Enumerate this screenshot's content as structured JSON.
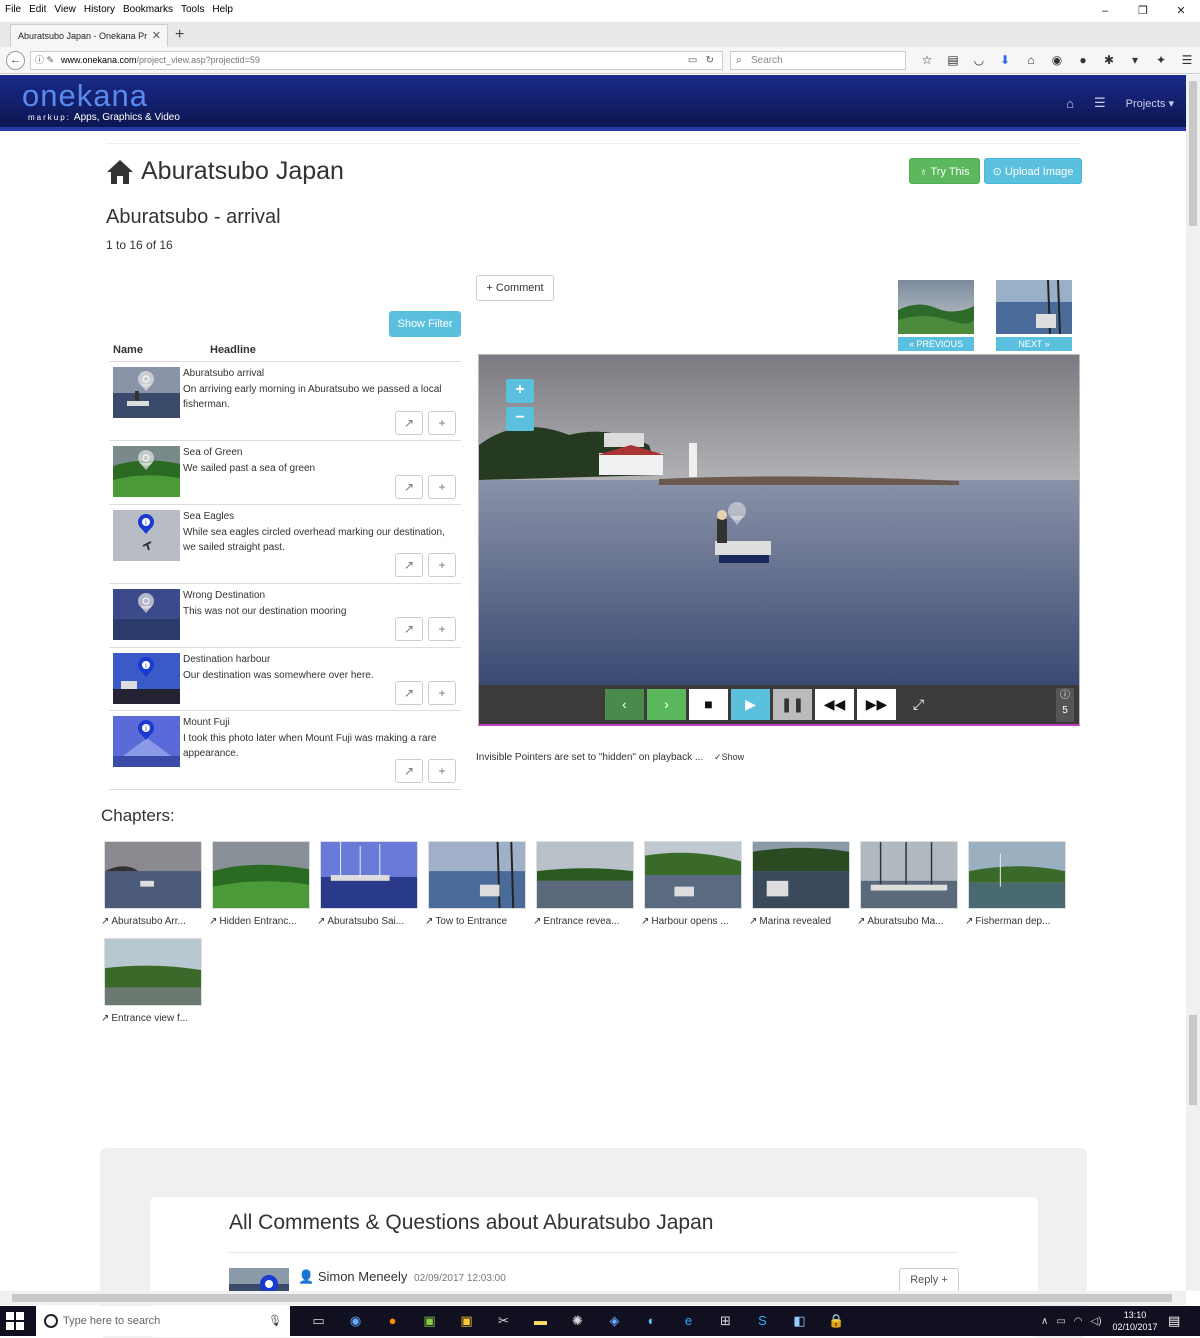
{
  "browser": {
    "menu": [
      "File",
      "Edit",
      "View",
      "History",
      "Bookmarks",
      "Tools",
      "Help"
    ],
    "window_controls": [
      "–",
      "❐",
      "✕"
    ],
    "tab_title": "Aburatsubo Japan - Onekana Pr",
    "url_host": "www.onekana.com",
    "url_path": "/project_view.asp?projectid=59",
    "search_placeholder": "Search"
  },
  "site": {
    "logo": "onekana",
    "logo_markup": "markup:",
    "logo_tagline": "Apps, Graphics & Video",
    "nav_projects": "Projects ▾"
  },
  "page": {
    "project_title": "Aburatsubo Japan",
    "try_label": "Try This",
    "upload_label": "Upload Image",
    "chapter_title": "Aburatsubo - arrival",
    "count_text": "1 to 16 of 16",
    "filter_label": "Show Filter",
    "comment_label": "Comment",
    "prev_label": "PREVIOUS",
    "next_label": "NEXT",
    "col_name": "Name",
    "col_headline": "Headline"
  },
  "items": [
    {
      "title": "Aburatsubo arrival",
      "desc": "On arriving early morning in Aburatsubo we passed a local fisherman."
    },
    {
      "title": "Sea of Green",
      "desc": "We sailed past a sea of green"
    },
    {
      "title": "Sea Eagles",
      "desc": "While sea eagles circled overhead marking our destination, we sailed straight past."
    },
    {
      "title": "Wrong Destination",
      "desc": "This was not our destination mooring"
    },
    {
      "title": "Destination harbour",
      "desc": "Our destination was somewhere over here."
    },
    {
      "title": "Mount Fuji",
      "desc": "I took this photo later when Mount Fuji was making a rare appearance."
    }
  ],
  "viewer": {
    "pointer_count": "5",
    "note": "Invisible Pointers are set to \"hidden\" on playback ...",
    "show_label": "Show"
  },
  "chapters": {
    "heading": "Chapters:",
    "items": [
      "Aburatsubo Arr...",
      "Hidden Entranc...",
      "Aburatsubo Sai...",
      "Tow to Entrance",
      "Entrance revea...",
      "Harbour opens ...",
      "Marina revealed",
      "Aburatsubo Ma...",
      "Fisherman dep...",
      "Entrance view f..."
    ]
  },
  "comments": {
    "heading": "All Comments & Questions about Aburatsubo Japan",
    "author": "Simon Meneely",
    "date": "02/09/2017 12:03:00",
    "reply_label": "Reply"
  },
  "taskbar": {
    "search_placeholder": "Type here to search",
    "time": "13:10",
    "date": "02/10/2017"
  },
  "colors": {
    "nav_bg": "#0c1650",
    "success": "#5cb85c",
    "info": "#5bc0de",
    "viewer_border": "#c040c0"
  }
}
